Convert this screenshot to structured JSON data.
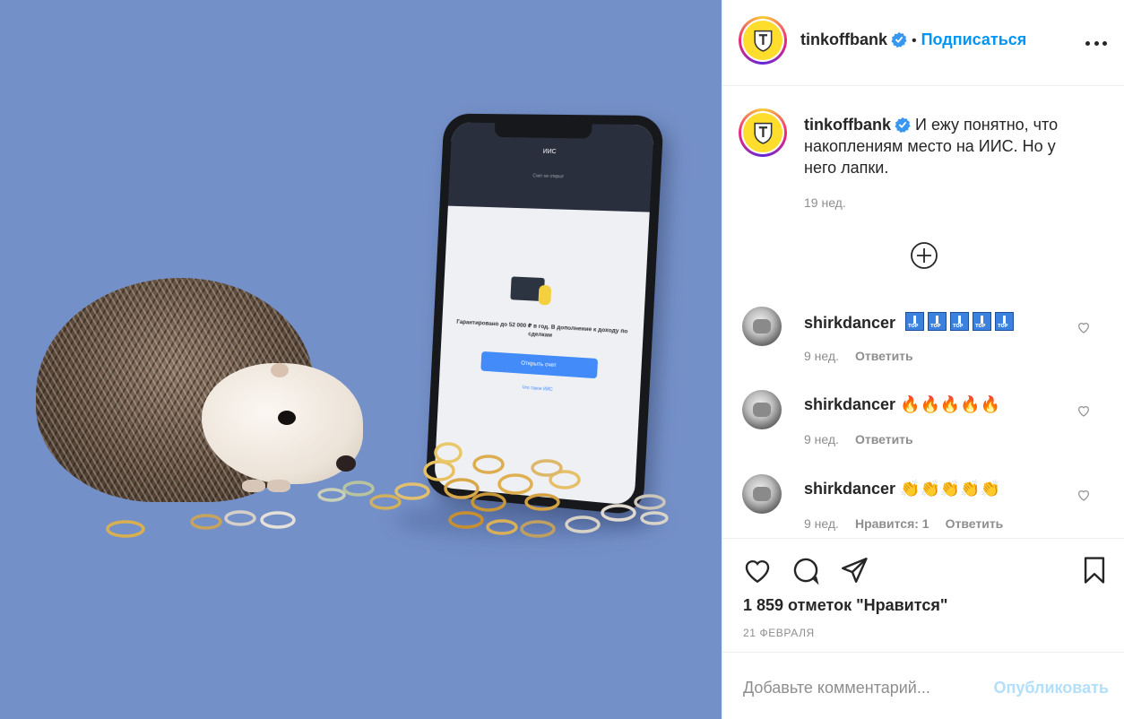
{
  "post": {
    "author": "tinkoffbank",
    "follow_label": "Подписаться",
    "separator": "•",
    "caption": "И ежу понятно, что накоплениям место на ИИС. Но у него лапки.",
    "time": "19 нед.",
    "likes": "1 859 отметок \"Нравится\"",
    "date": "21 ФЕВРАЛЯ"
  },
  "image": {
    "background_color": "#7490c8",
    "phone_screen": {
      "title": "ИИС",
      "subtitle": "Счет не открыт",
      "text": "Гарантировано до 52 000 ₽ в год. В дополнение к доходу по сделкам",
      "button": "Открыть счет",
      "link": "Что такое ИИС"
    }
  },
  "comments": [
    {
      "author": "shirkdancer",
      "text": "",
      "badges": 5,
      "badge_icon": "top-arrow-emoji",
      "time": "9 нед.",
      "likes": "",
      "reply": "Ответить"
    },
    {
      "author": "shirkdancer",
      "text": "🔥🔥🔥🔥🔥",
      "time": "9 нед.",
      "likes": "",
      "reply": "Ответить"
    },
    {
      "author": "shirkdancer",
      "text": "👏👏👏👏👏",
      "time": "9 нед.",
      "likes": "Нравится: 1",
      "reply": "Ответить"
    }
  ],
  "add_comment": {
    "placeholder": "Добавьте комментарий...",
    "publish_label": "Опубликовать"
  },
  "colors": {
    "link_blue": "#0095f6",
    "publish_disabled": "#b2dffc",
    "text_primary": "#262626",
    "text_secondary": "#8e8e8e",
    "brand_yellow": "#ffdd2d"
  }
}
